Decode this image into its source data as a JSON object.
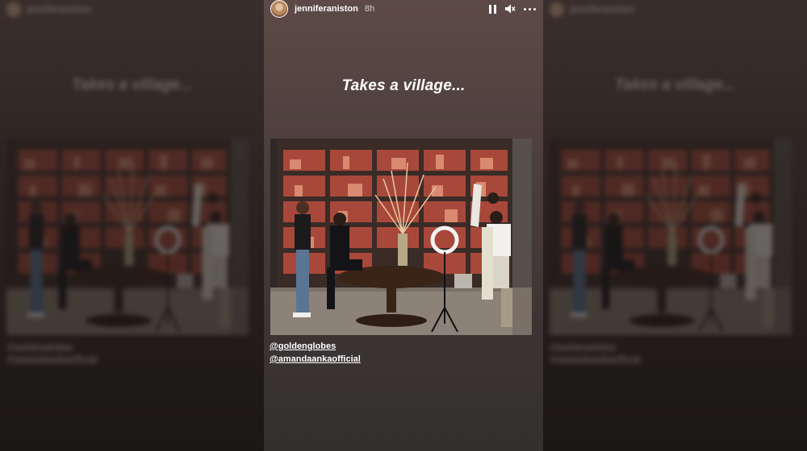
{
  "story": {
    "username": "jenniferaniston",
    "time": "8h",
    "caption": "Takes a village...",
    "mentions": [
      "@goldenglobes",
      "@amandaankaofficial"
    ]
  },
  "controls": {
    "pause_icon": "pause-icon",
    "mute_icon": "speaker-muted-icon",
    "more_icon": "more-options-icon"
  },
  "colors": {
    "story_bg_top": "#5d4a46",
    "story_bg_bottom": "#343030",
    "text": "#ffffff",
    "shelf_glow": "#c0503c"
  }
}
